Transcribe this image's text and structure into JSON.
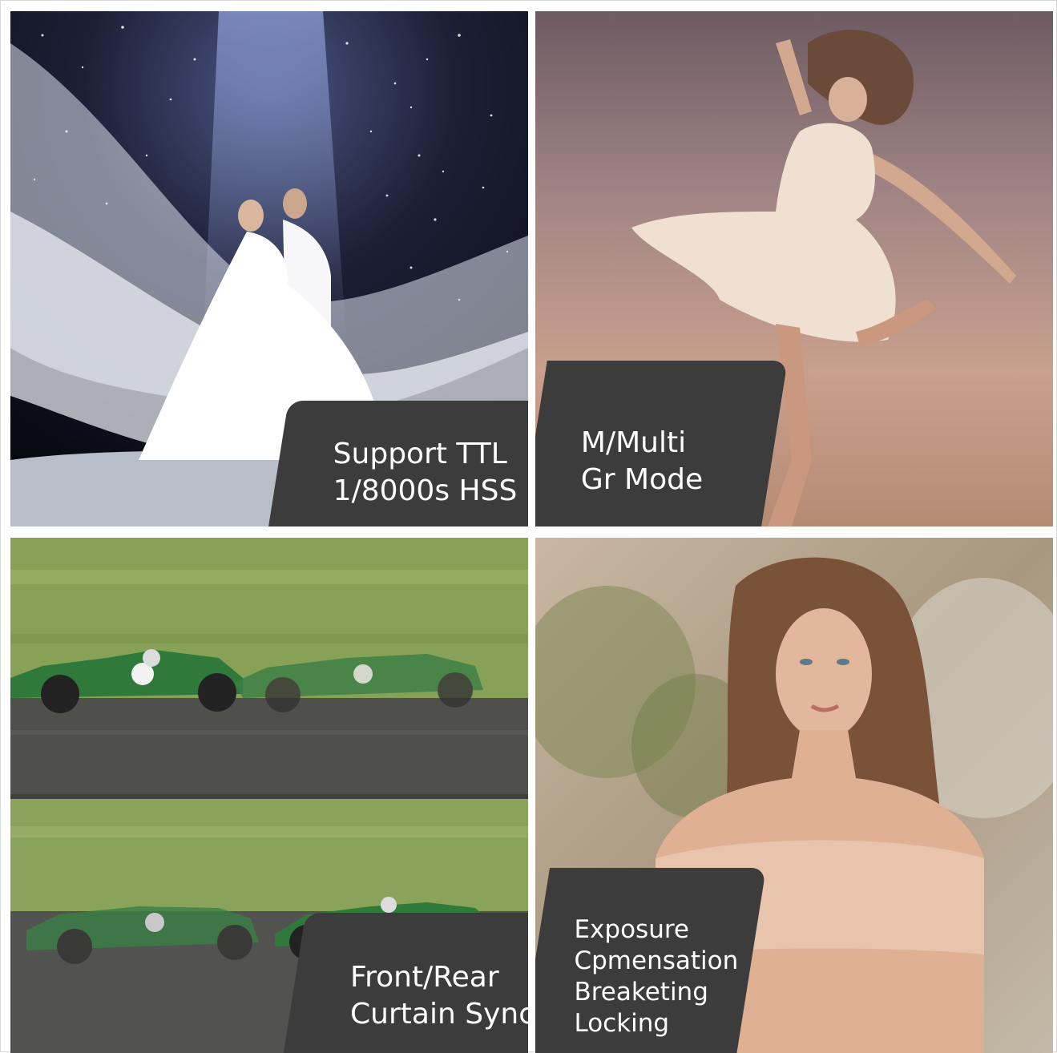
{
  "tiles": [
    {
      "id": "wedding",
      "scene": "wedding-couple-photo",
      "caption_lines": [
        "Support TTL",
        "1/8000s HSS"
      ]
    },
    {
      "id": "dancer",
      "scene": "dancer-photo",
      "caption_lines": [
        "M/Multi",
        "Gr Mode"
      ]
    },
    {
      "id": "race",
      "scene": "race-cars-photo",
      "caption_lines": [
        "Front/Rear",
        "Curtain Sync"
      ]
    },
    {
      "id": "portrait",
      "scene": "portrait-photo",
      "caption_lines": [
        "Exposure",
        "Cpmensation",
        "Breaketing",
        "Locking"
      ]
    }
  ],
  "colors": {
    "badge": "#3c3c3c",
    "badge_text": "#ffffff",
    "background": "#ffffff"
  }
}
